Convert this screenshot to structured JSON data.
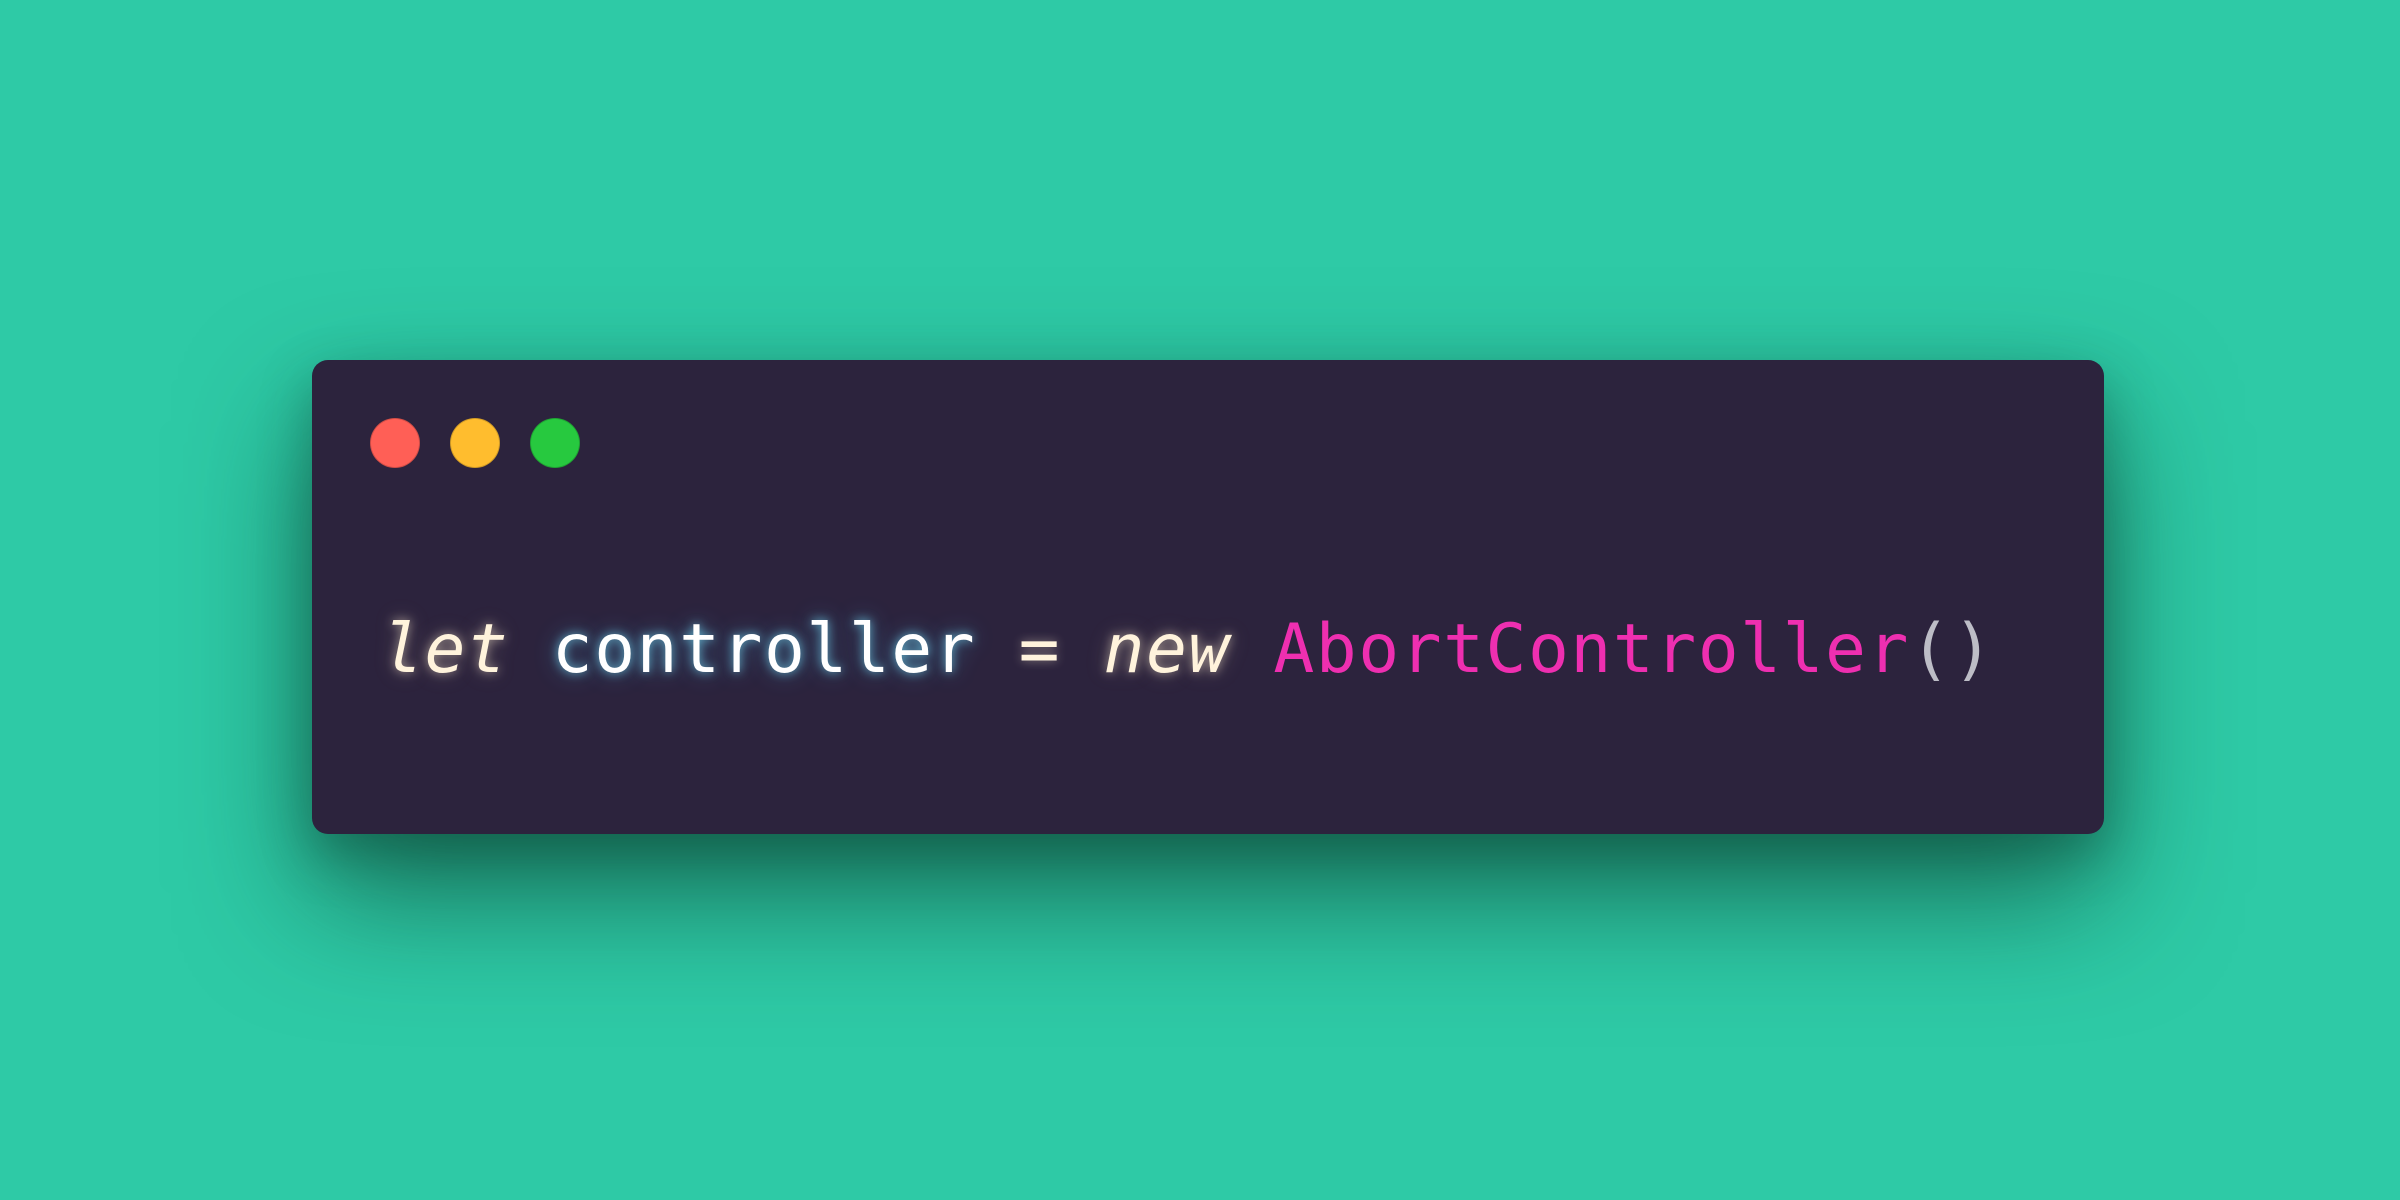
{
  "colors": {
    "background": "#2ecaa6",
    "window_background": "#2c233d",
    "close_dot": "#ff5f56",
    "minimize_dot": "#ffbd2e",
    "maximize_dot": "#27c93f",
    "keyword": "#fff3dc",
    "identifier": "#ffffff",
    "operator": "#fff3dc",
    "class_name": "#ee2fb0",
    "paren": "#bdbdc6"
  },
  "window": {
    "controls": [
      {
        "name": "close",
        "icon": "close-dot-icon"
      },
      {
        "name": "minimize",
        "icon": "minimize-dot-icon"
      },
      {
        "name": "maximize",
        "icon": "maximize-dot-icon"
      }
    ]
  },
  "code": {
    "tokens": {
      "keyword_let": "let",
      "space1": " ",
      "identifier": "controller",
      "space2": " ",
      "operator": "=",
      "space3": " ",
      "keyword_new": "new",
      "space4": " ",
      "class_name": "AbortController",
      "paren_open": "(",
      "paren_close": ")"
    }
  }
}
